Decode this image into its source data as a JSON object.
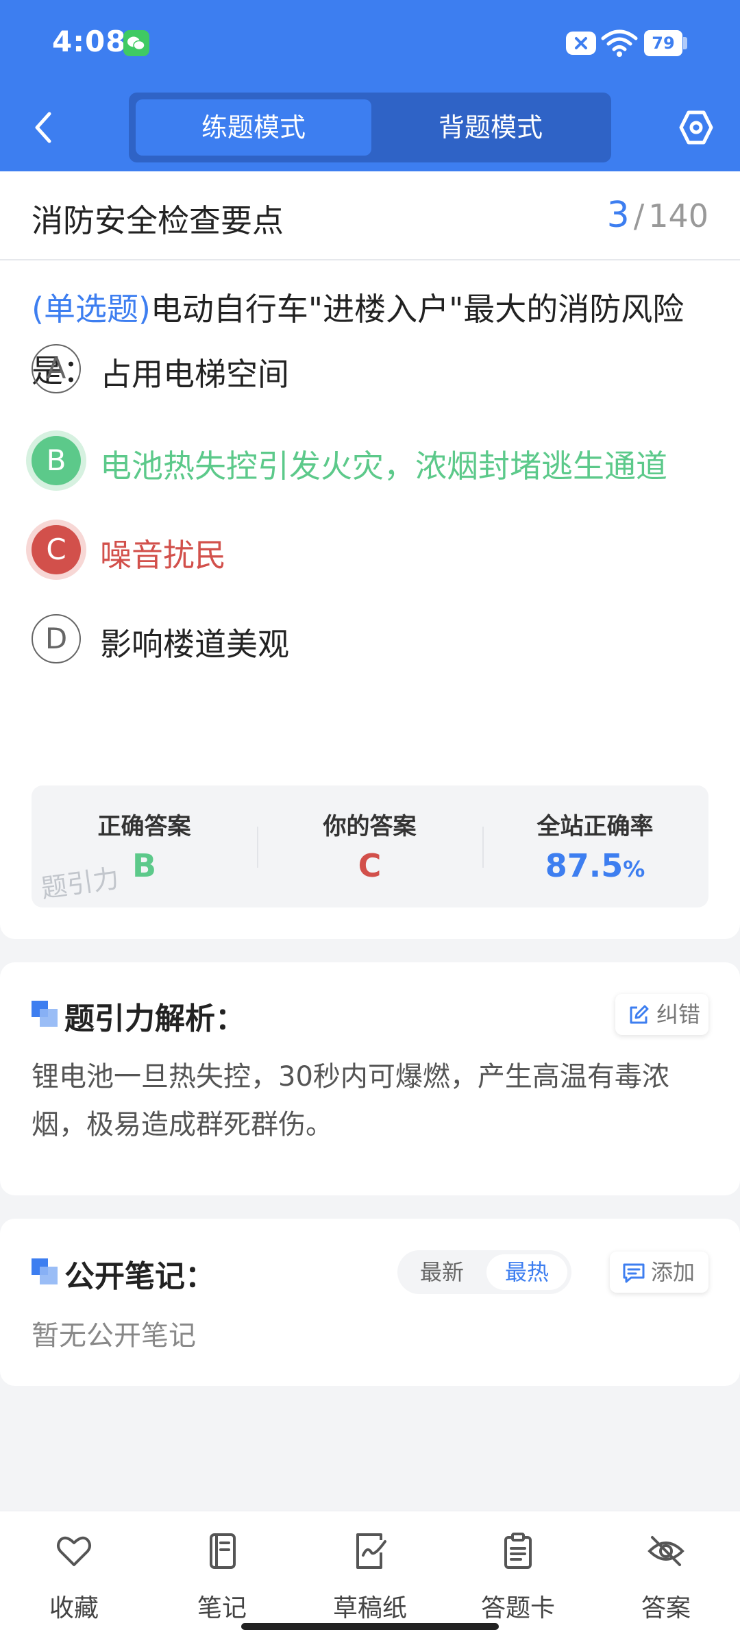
{
  "status_bar": {
    "time": "4:08",
    "battery": "79"
  },
  "header": {
    "tabs": [
      {
        "label": "练题模式",
        "active": true
      },
      {
        "label": "背题模式",
        "active": false
      }
    ]
  },
  "topic": {
    "title": "消防安全检查要点",
    "current": "3",
    "separator": "/",
    "total": "140"
  },
  "question": {
    "type": "(单选题)",
    "text": "电动自行车\"进楼入户\"最大的消防风险是："
  },
  "options": [
    {
      "letter": "A",
      "text": "占用电梯空间",
      "state": "normal"
    },
    {
      "letter": "B",
      "text": "电池热失控引发火灾，浓烟封堵逃生通道",
      "state": "correct"
    },
    {
      "letter": "C",
      "text": "噪音扰民",
      "state": "wrong"
    },
    {
      "letter": "D",
      "text": "影响楼道美观",
      "state": "normal"
    }
  ],
  "result": {
    "correct_label": "正确答案",
    "correct_value": "B",
    "your_label": "你的答案",
    "your_value": "C",
    "rate_label": "全站正确率",
    "rate_value": "87.5",
    "rate_unit": "%",
    "watermark": "题引力"
  },
  "analysis": {
    "title": "题引力解析：",
    "correct_button": "纠错",
    "text": "锂电池一旦热失控，30秒内可爆燃，产生高温有毒浓烟，极易造成群死群伤。"
  },
  "notes": {
    "title": "公开笔记：",
    "sort_options": [
      "最新",
      "最热"
    ],
    "add_button": "添加",
    "empty_text": "暂无公开笔记"
  },
  "bottom_nav": [
    {
      "label": "收藏",
      "icon": "heart-icon"
    },
    {
      "label": "笔记",
      "icon": "notebook-icon"
    },
    {
      "label": "草稿纸",
      "icon": "draft-paper-icon"
    },
    {
      "label": "答题卡",
      "icon": "answer-sheet-icon"
    },
    {
      "label": "答案",
      "icon": "eye-off-icon"
    }
  ],
  "colors": {
    "primary": "#3d7ef0",
    "correct": "#5cc98a",
    "wrong": "#d2504b"
  }
}
